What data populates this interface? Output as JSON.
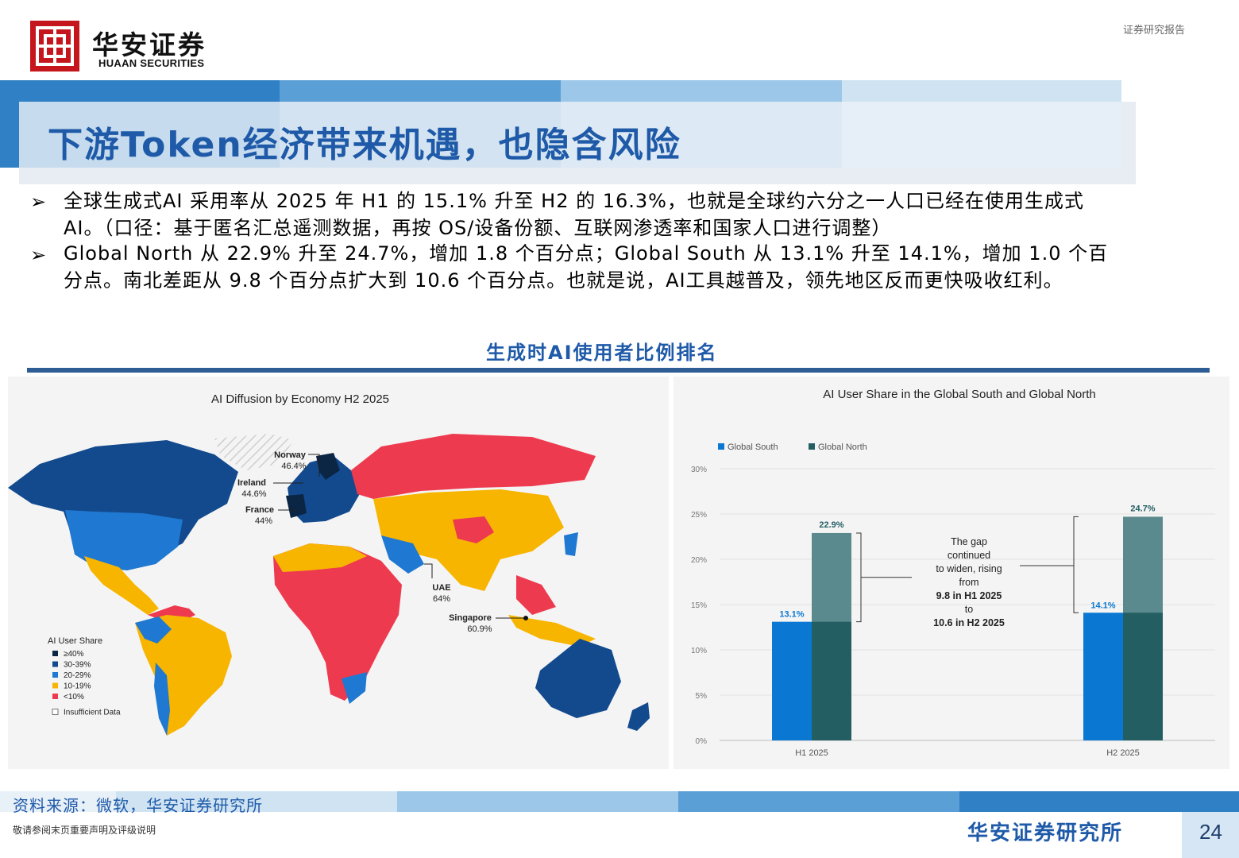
{
  "header": {
    "brand_cn": "华安证券",
    "brand_en": "HUAAN SECURITIES",
    "report_tag": "证券研究报告"
  },
  "title": "下游Token经济带来机遇，也隐含风险",
  "bullets": [
    "全球生成式AI 采用率从 2025 年 H1 的 15.1% 升至 H2 的 16.3%，也就是全球约六分之一人口已经在使用生成式AI。（口径：基于匿名汇总遥测数据，再按 OS/设备份额、互联网渗透率和国家人口进行调整）",
    "Global North 从 22.9% 升至 24.7%，增加 1.8 个百分点；Global South 从 13.1% 升至 14.1%，增加 1.0 个百分点。南北差距从 9.8 个百分点扩大到 10.6 个百分点。也就是说，AI工具越普及，领先地区反而更快吸收红利。"
  ],
  "figure_title": "生成时AI使用者比例排名",
  "map": {
    "title": "AI Diffusion by Economy H2 2025",
    "callouts": [
      {
        "name": "Norway",
        "value": "46.4%"
      },
      {
        "name": "Ireland",
        "value": "44.6%"
      },
      {
        "name": "France",
        "value": "44%"
      },
      {
        "name": "UAE",
        "value": "64%"
      },
      {
        "name": "Singapore",
        "value": "60.9%"
      }
    ],
    "legend_title": "AI User Share",
    "legend": [
      {
        "label": "≥40%",
        "color": "#0b2545"
      },
      {
        "label": "30-39%",
        "color": "#134a8e"
      },
      {
        "label": "20-29%",
        "color": "#1f78d1"
      },
      {
        "label": "10-19%",
        "color": "#f7b500"
      },
      {
        "label": "<10%",
        "color": "#ee3a4f"
      },
      {
        "label": "Insufficient Data",
        "color": "#ffffff"
      }
    ]
  },
  "chart_data": {
    "type": "bar",
    "title": "AI User Share in the Global South and Global North",
    "categories": [
      "H1 2025",
      "H2 2025"
    ],
    "series": [
      {
        "name": "Global South",
        "values": [
          13.1,
          14.1
        ],
        "labels": [
          "13.1%",
          "14.1%"
        ],
        "color": "#0a78d2"
      },
      {
        "name": "Global North",
        "values": [
          22.9,
          24.7
        ],
        "labels": [
          "22.9%",
          "24.7%"
        ],
        "color": "#235e63"
      }
    ],
    "y_ticks": [
      "0%",
      "5%",
      "10%",
      "15%",
      "20%",
      "25%",
      "30%"
    ],
    "ylim": [
      0,
      30
    ],
    "annotation": [
      "The gap",
      "continued",
      "to widen, rising",
      "from",
      "9.8 in H1 2025",
      "to",
      "10.6 in H2 2025"
    ],
    "legend_position": "top-left"
  },
  "footer": {
    "source": "资料来源：微软，华安证券研究所",
    "disclaimer": "敬请参阅末页重要声明及评级说明",
    "brand": "华安证券研究所",
    "page": "24"
  }
}
